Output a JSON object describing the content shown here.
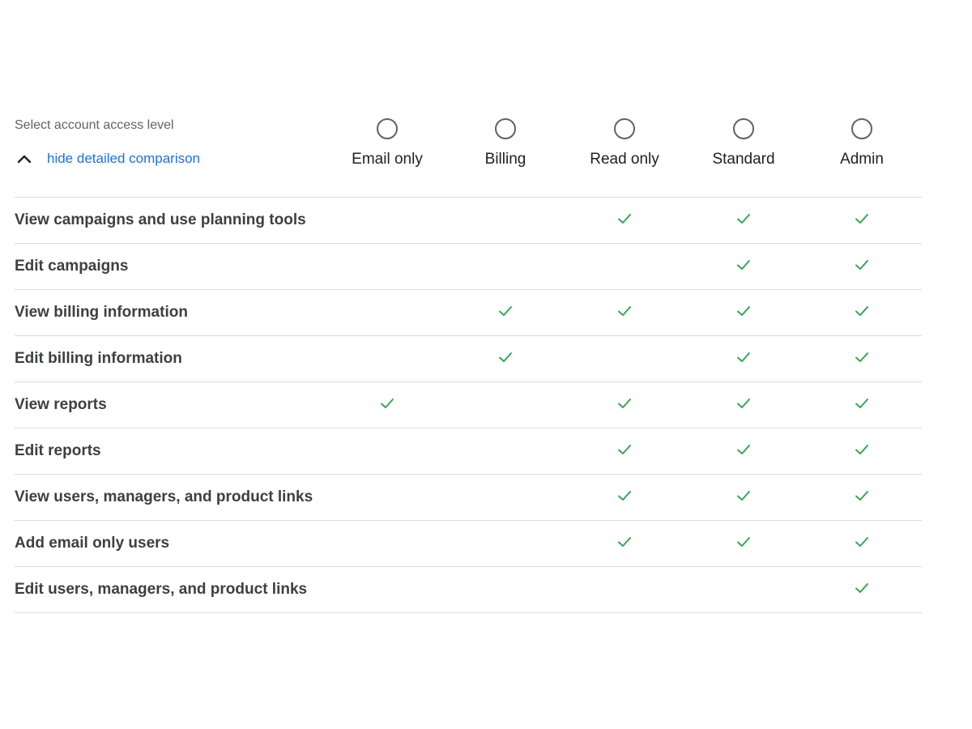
{
  "header": {
    "access_label": "Select account access level",
    "toggle_label": "hide detailed comparison",
    "toggle_icon": "chevron-up-icon"
  },
  "levels": [
    {
      "label": "Email only",
      "selected": false
    },
    {
      "label": "Billing",
      "selected": false
    },
    {
      "label": "Read only",
      "selected": false
    },
    {
      "label": "Standard",
      "selected": false
    },
    {
      "label": "Admin",
      "selected": false
    }
  ],
  "permissions": [
    {
      "label": "View campaigns and use planning tools",
      "allowed": [
        false,
        false,
        true,
        true,
        true
      ]
    },
    {
      "label": "Edit campaigns",
      "allowed": [
        false,
        false,
        false,
        true,
        true
      ]
    },
    {
      "label": "View billing information",
      "allowed": [
        false,
        true,
        true,
        true,
        true
      ]
    },
    {
      "label": "Edit billing information",
      "allowed": [
        false,
        true,
        false,
        true,
        true
      ]
    },
    {
      "label": "View reports",
      "allowed": [
        true,
        false,
        true,
        true,
        true
      ]
    },
    {
      "label": "Edit reports",
      "allowed": [
        false,
        false,
        true,
        true,
        true
      ]
    },
    {
      "label": "View users, managers, and product links",
      "allowed": [
        false,
        false,
        true,
        true,
        true
      ]
    },
    {
      "label": "Add email only users",
      "allowed": [
        false,
        false,
        true,
        true,
        true
      ]
    },
    {
      "label": "Edit users, managers, and product links",
      "allowed": [
        false,
        false,
        false,
        false,
        true
      ]
    }
  ],
  "colors": {
    "check": "#34a853",
    "link": "#1a73e8",
    "divider": "#dadce0",
    "radio_outline": "#5f6368"
  }
}
